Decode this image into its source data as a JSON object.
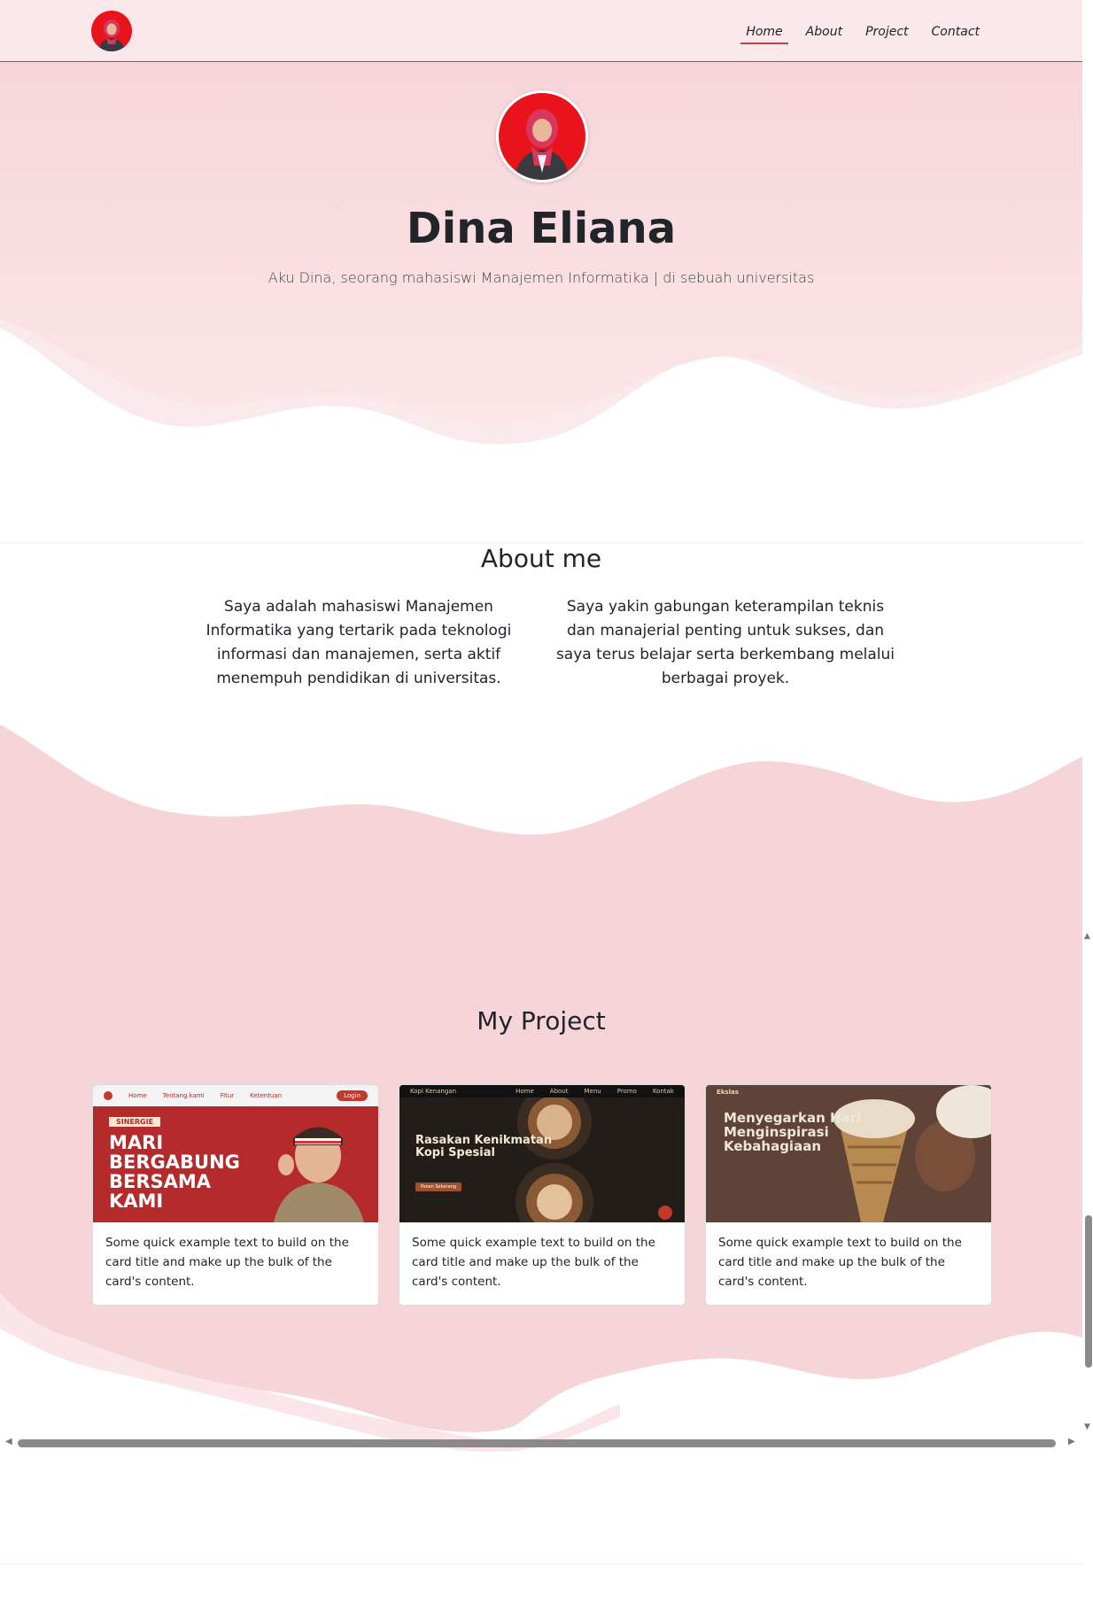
{
  "navbar": {
    "links": [
      "Home",
      "About",
      "Project",
      "Contact"
    ],
    "active": "Home"
  },
  "hero": {
    "name": "Dina Eliana",
    "subtitle": "Aku Dina, seorang mahasiswi Manajemen Informatika | di sebuah universitas"
  },
  "about": {
    "title": "About me",
    "left": "Saya adalah mahasiswi Manajemen Informatika yang tertarik pada teknologi informasi dan manajemen, serta aktif menempuh pendidikan di universitas.",
    "right": "Saya yakin gabungan keterampilan teknis dan manajerial penting untuk sukses, dan saya terus belajar serta berkembang melalui berbagai proyek."
  },
  "projects": {
    "title": "My Project",
    "cards": [
      {
        "text": "Some quick example text to build on the card title and make up the bulk of the card's content.",
        "preview": {
          "nav": [
            "Home",
            "Tentang kami",
            "Fitur",
            "Ketentuan"
          ],
          "button": "Login",
          "badge": "SINERGIE",
          "headline": [
            "MARI",
            "BERGABUNG",
            "BERSAMA",
            "KAMI"
          ]
        }
      },
      {
        "text": "Some quick example text to build on the card title and make up the bulk of the card's content.",
        "preview": {
          "brand": "Kopi Kenangan",
          "nav": [
            "Home",
            "About",
            "Menu",
            "Promo",
            "Kontak"
          ],
          "headline": [
            "Rasakan Kenikmatan",
            "Kopi Spesial"
          ],
          "button": "Pesan Sekarang"
        }
      },
      {
        "text": "Some quick example text to build on the card title and make up the bulk of the card's content.",
        "preview": {
          "brand": "Ekslas",
          "headline": [
            "Menyegarkan Hari",
            "Menginspirasi",
            "Kebahagiaan"
          ]
        }
      }
    ]
  },
  "colors": {
    "pink_light": "#fbe4e6",
    "pink": "#f6d5d9",
    "accent": "#b8454f",
    "avatar_bg": "#e8131b"
  }
}
